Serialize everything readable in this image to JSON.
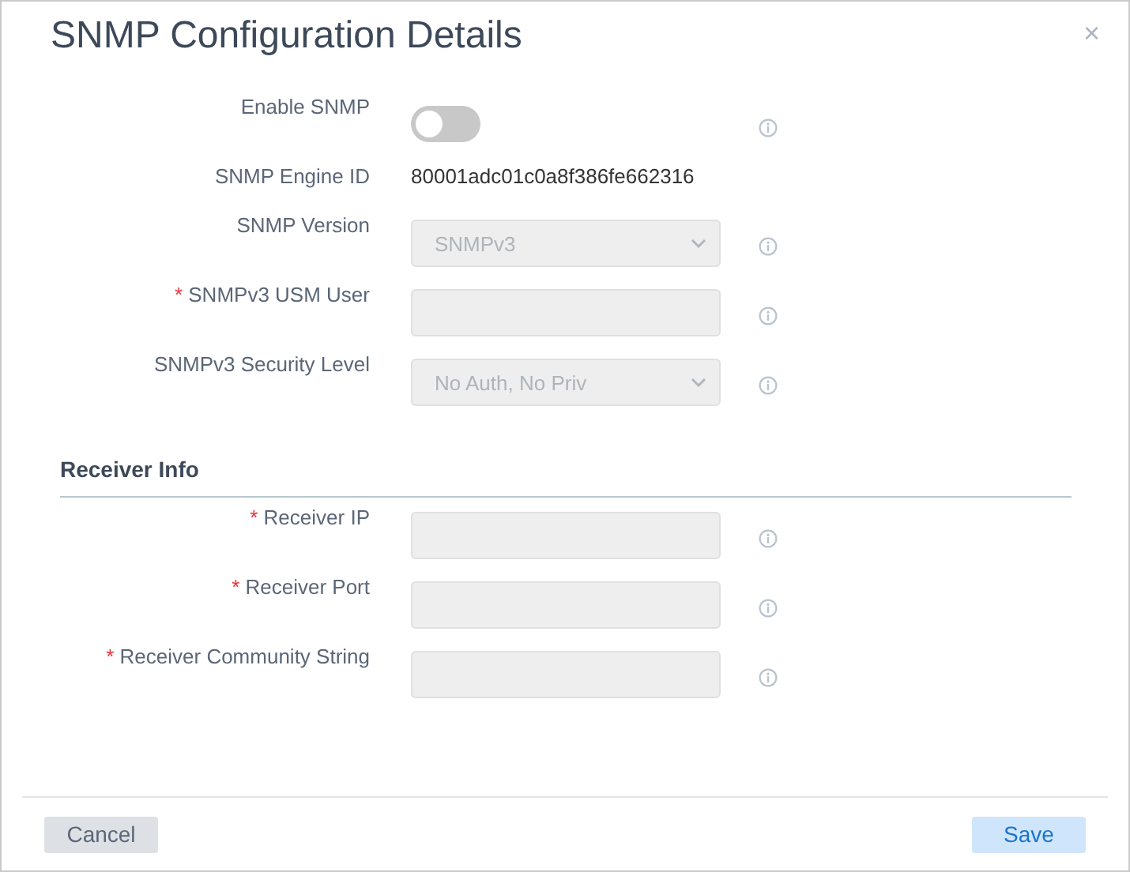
{
  "dialog": {
    "title": "SNMP Configuration Details",
    "close": "×"
  },
  "fields": [
    {
      "kind": "toggle",
      "label": "Enable SNMP",
      "on": false
    },
    {
      "kind": "text",
      "label": "SNMP Engine ID",
      "value": "80001adc01c0a8f386fe662316"
    },
    {
      "kind": "select",
      "label": "SNMP Version",
      "value": "SNMPv3",
      "disabled": true
    },
    {
      "kind": "input",
      "mark": "*",
      "label": "SNMPv3 USM User",
      "disabled": true
    },
    {
      "kind": "select",
      "label": "SNMPv3 Security Level",
      "value": "No Auth, No Priv",
      "disabled": true
    }
  ],
  "sections": [
    {
      "title": "Receiver Info",
      "fields": [
        {
          "kind": "input",
          "mark": "*",
          "label": "Receiver IP",
          "disabled": true
        },
        {
          "kind": "input",
          "mark": "*",
          "label": "Receiver Port",
          "disabled": true
        },
        {
          "kind": "input",
          "mark": "*",
          "label": "Receiver Community String",
          "disabled": true
        }
      ]
    }
  ],
  "buttons": [
    {
      "label": "Cancel",
      "kind": "secondary"
    },
    {
      "label": "Save",
      "kind": "primary"
    }
  ]
}
